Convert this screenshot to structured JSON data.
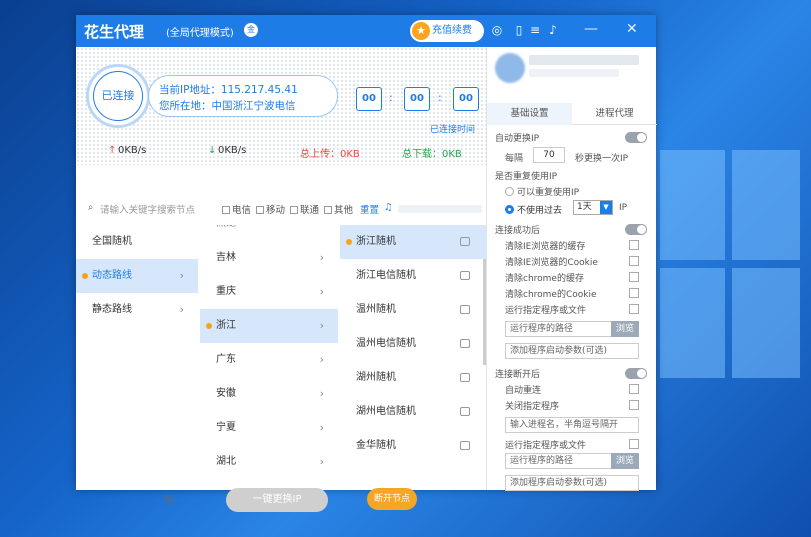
{
  "app": {
    "logo": "花生代理",
    "mode": "(全局代理模式)",
    "vip_badge": "金"
  },
  "titlebar": {
    "recharge": "充值续费",
    "minimize": "—",
    "close": "✕"
  },
  "status": {
    "connected_label": "已连接",
    "ip_line": "当前IP地址：115.217.45.41",
    "location_line": "您所在地：中国浙江宁波电信",
    "timer_h": "00",
    "timer_m": "00",
    "timer_s": "00",
    "conn_time_label": "已连接时间"
  },
  "stats": {
    "upload_speed": "0KB/s",
    "download_speed": "0KB/s",
    "total_upload": "总上传：0KB",
    "total_download": "总下载：0KB"
  },
  "filter": {
    "search_placeholder": "请输入关键字搜索节点",
    "opts": [
      "电信",
      "移动",
      "联通",
      "其他"
    ],
    "reset": "重置"
  },
  "col1": [
    "全国随机",
    "动态路线",
    "静态路线"
  ],
  "col2": [
    "吉林",
    "重庆",
    "浙江",
    "广东",
    "安徽",
    "宁夏",
    "湖北"
  ],
  "col2_top_partial": "黑龙",
  "col3": [
    "浙江随机",
    "浙江电信随机",
    "温州随机",
    "温州电信随机",
    "湖州随机",
    "湖州电信随机",
    "金华随机"
  ],
  "bottom": {
    "one_key": "一键更换IP",
    "disconnect": "断开节点"
  },
  "right": {
    "tabs": [
      "基础设置",
      "进程代理"
    ],
    "auto_ip": "自动更换IP",
    "every": "每隔",
    "interval": "70",
    "every_suffix": "秒更换一次IP",
    "reuse": "是否重复使用IP",
    "reuse_yes": "可以重复使用IP",
    "reuse_no": "不使用过去",
    "days": "1天",
    "ip_suffix": "IP",
    "after_connect": "连接成功后",
    "after_items": [
      "清除IE浏览器的缓存",
      "清除IE浏览器的Cookie",
      "清除chrome的缓存",
      "清除chrome的Cookie",
      "运行指定程序或文件"
    ],
    "path_ph": "运行程序的路径",
    "browse": "浏览",
    "args_ph": "添加程序启动参数(可选)",
    "after_disconnect": "连接断开后",
    "auto_reconnect": "自动重连",
    "close_proc": "关闭指定程序",
    "proc_ph": "输入进程名，半角逗号隔开",
    "run_prog": "运行指定程序或文件"
  }
}
